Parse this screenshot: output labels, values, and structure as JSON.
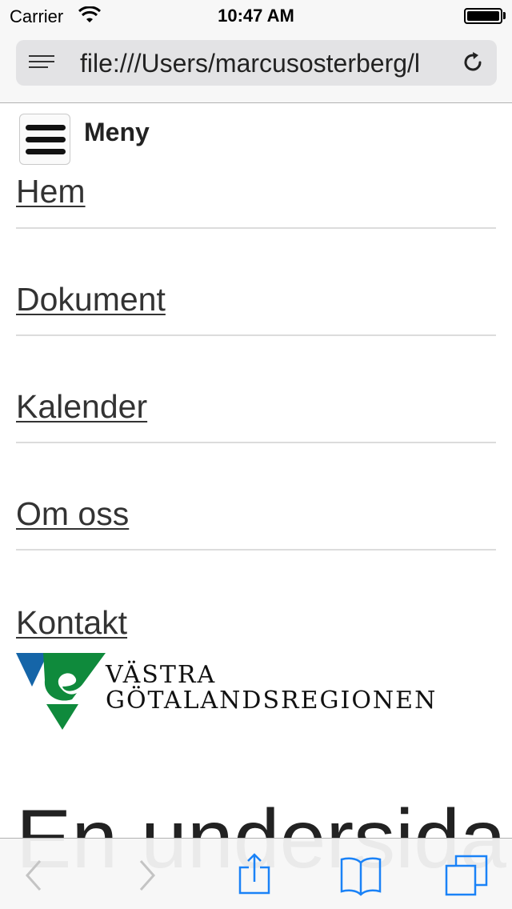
{
  "status_bar": {
    "carrier": "Carrier",
    "time": "10:47 AM"
  },
  "browser": {
    "url": "file:///Users/marcusosterberg/l"
  },
  "menu": {
    "label": "Meny",
    "items": [
      {
        "label": "Hem"
      },
      {
        "label": "Dokument"
      },
      {
        "label": "Kalender"
      },
      {
        "label": "Om oss"
      },
      {
        "label": "Kontakt"
      }
    ]
  },
  "logo": {
    "line1": "VÄSTRA",
    "line2": "GÖTALANDSREGIONEN",
    "colors": {
      "blue": "#1565a8",
      "green": "#0f8a3c"
    }
  },
  "page": {
    "heading": "En undersida"
  },
  "toolbar": {
    "icons": [
      "back-icon",
      "forward-icon",
      "share-icon",
      "bookmarks-icon",
      "tabs-icon"
    ],
    "accent": "#1a82f7"
  }
}
